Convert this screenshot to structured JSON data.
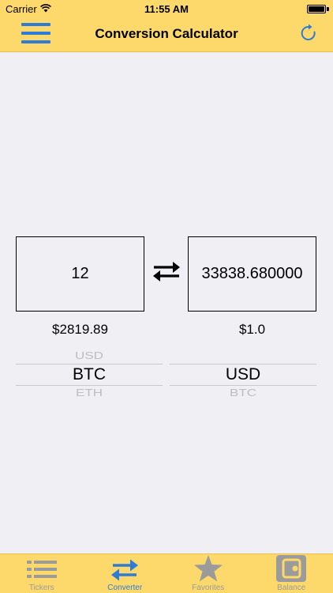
{
  "status_bar": {
    "carrier": "Carrier",
    "time": "11:55 AM"
  },
  "nav": {
    "title": "Conversion Calculator",
    "menu_icon": "hamburger-icon",
    "refresh_icon": "refresh-icon"
  },
  "converter": {
    "from_amount": "12",
    "to_amount": "33838.680000",
    "from_price": "$2819.89",
    "to_price": "$1.0",
    "swap_icon": "swap-arrows-icon",
    "from_picker": {
      "above": "USD",
      "selected": "BTC",
      "below": "ETH"
    },
    "to_picker": {
      "selected": "USD",
      "below": "BTC"
    }
  },
  "tabs": [
    {
      "label": "Tickers",
      "icon": "list-icon",
      "active": false
    },
    {
      "label": "Converter",
      "icon": "swap-arrows-icon",
      "active": true
    },
    {
      "label": "Favorites",
      "icon": "star-icon",
      "active": false
    },
    {
      "label": "Balance",
      "icon": "wallet-icon",
      "active": false
    }
  ],
  "colors": {
    "bar": "#fdd86a",
    "accent": "#2f7bd8",
    "background": "#efeff4",
    "tab_inactive": "#9b9b9b"
  }
}
